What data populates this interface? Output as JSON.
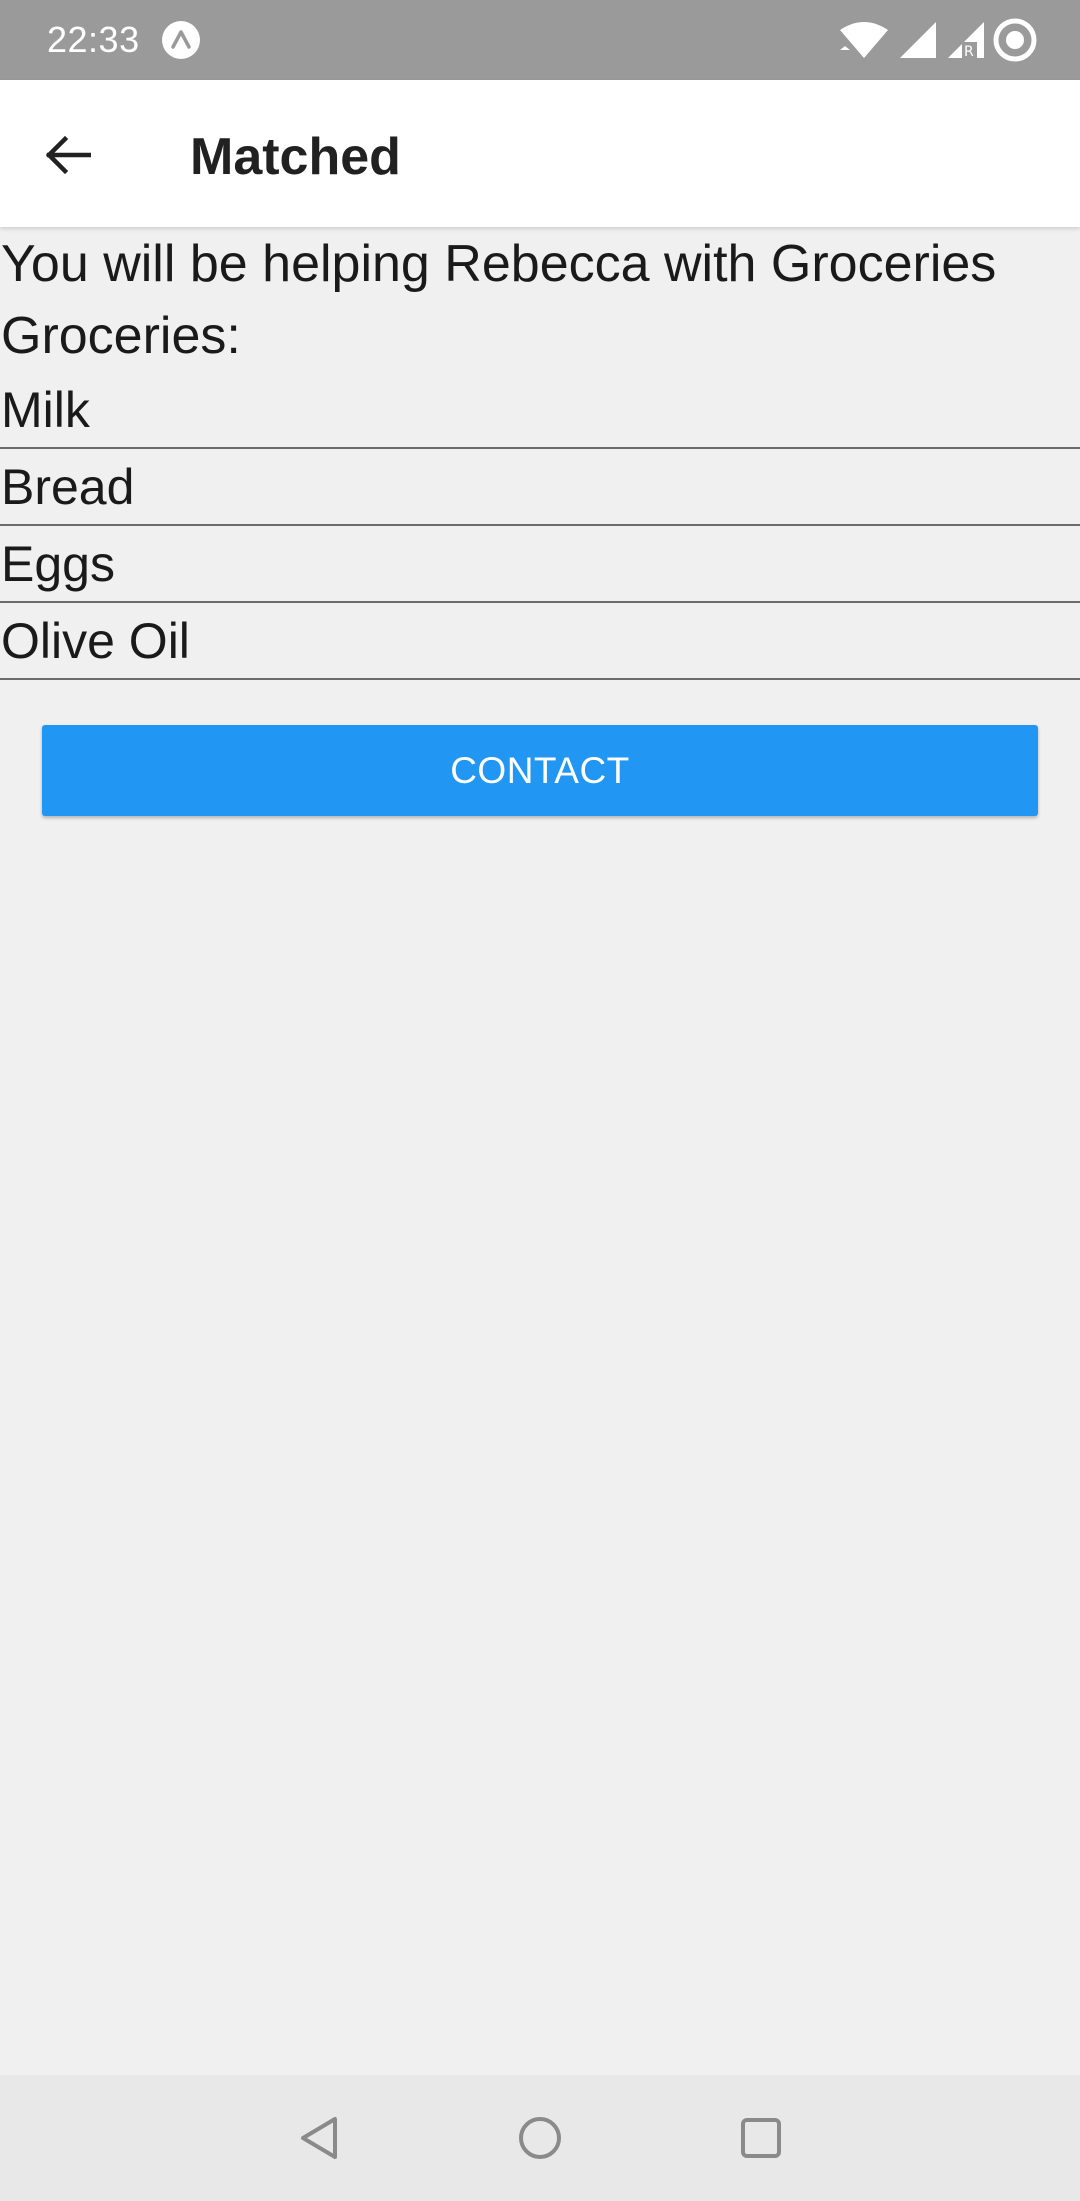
{
  "status_bar": {
    "time": "22:33",
    "app_icon": "expo-icon",
    "icons": [
      "wifi-icon",
      "signal-icon",
      "signal-roaming-icon",
      "sync-icon"
    ]
  },
  "app_bar": {
    "title": "Matched",
    "back_icon": "arrow-left-icon"
  },
  "main": {
    "intro": "You will be helping Rebecca with Groceries",
    "list_heading": "Groceries:",
    "items": [
      "Milk",
      "Bread",
      "Eggs",
      "Olive Oil"
    ],
    "contact_label": "CONTACT"
  },
  "nav_bar": {
    "icons": [
      "back-triangle-icon",
      "home-circle-icon",
      "recents-square-icon"
    ]
  },
  "colors": {
    "status_bar": "#9a9a9a",
    "accent": "#2196f3",
    "background": "#f0f0f0",
    "app_bar": "#ffffff",
    "nav_bar": "#e8e8e8"
  }
}
